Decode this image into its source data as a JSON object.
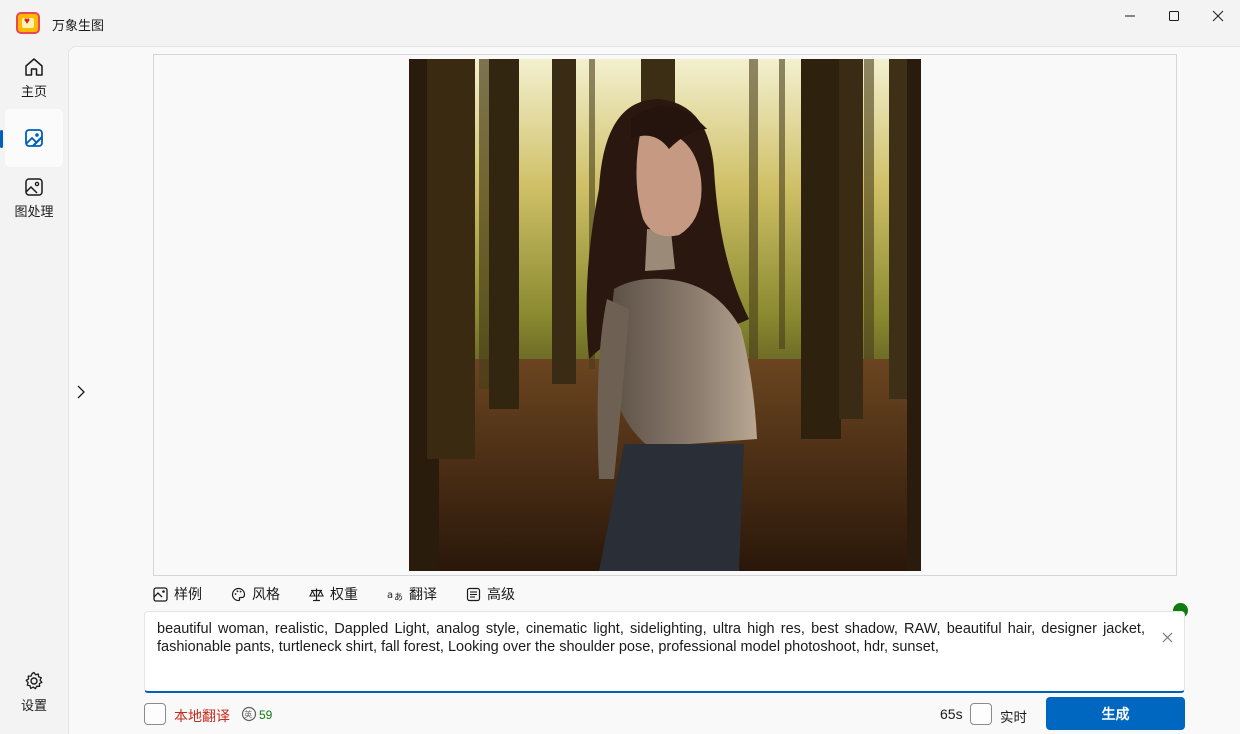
{
  "app": {
    "title": "万象生图"
  },
  "window_controls": {
    "minimize": "minimize",
    "maximize": "maximize",
    "close": "close"
  },
  "nav": {
    "items": [
      {
        "label": "主页",
        "icon": "home-icon"
      },
      {
        "label": "",
        "icon": "image-generate-icon",
        "active": true
      },
      {
        "label": "图处理",
        "icon": "image-edit-icon"
      }
    ],
    "settings_label": "设置"
  },
  "toolbar": {
    "examples": "样例",
    "style": "风格",
    "weight": "权重",
    "translate": "翻译",
    "advanced": "高级"
  },
  "prompt": {
    "value": "beautiful woman, realistic, Dappled Light, analog style, cinematic light, sidelighting, ultra high res, best shadow, RAW, beautiful hair, designer jacket, fashionable pants, turtleneck shirt, fall forest, Looking over the shoulder pose, professional model photoshoot, hdr, sunset,"
  },
  "footer": {
    "local_translate_label": "本地翻译",
    "local_translate_checked": false,
    "token_count": "59",
    "time": "65s",
    "realtime_label": "实时",
    "realtime_checked": false,
    "generate_label": "生成"
  },
  "colors": {
    "accent": "#0067c0",
    "status": "#107c10",
    "warn_text": "#c42b1c"
  }
}
